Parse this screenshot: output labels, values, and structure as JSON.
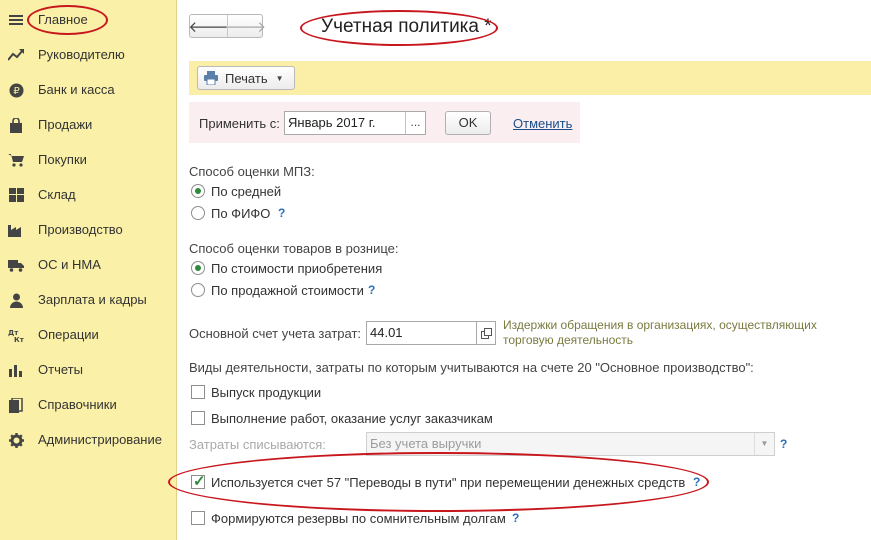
{
  "sidebar": {
    "items": [
      {
        "label": "Главное",
        "icon": "menu-icon"
      },
      {
        "label": "Руководителю",
        "icon": "trend-icon"
      },
      {
        "label": "Банк и касса",
        "icon": "ruble-icon"
      },
      {
        "label": "Продажи",
        "icon": "bag-icon"
      },
      {
        "label": "Покупки",
        "icon": "cart-icon"
      },
      {
        "label": "Склад",
        "icon": "warehouse-icon"
      },
      {
        "label": "Производство",
        "icon": "factory-icon"
      },
      {
        "label": "ОС и НМА",
        "icon": "truck-icon"
      },
      {
        "label": "Зарплата и кадры",
        "icon": "person-icon"
      },
      {
        "label": "Операции",
        "icon": "dt-kt-icon"
      },
      {
        "label": "Отчеты",
        "icon": "bar-chart-icon"
      },
      {
        "label": "Справочники",
        "icon": "books-icon"
      },
      {
        "label": "Администрирование",
        "icon": "gear-icon"
      }
    ]
  },
  "header": {
    "title": "Учетная политика *",
    "back_label": "🡐",
    "forward_label": "🡒"
  },
  "toolbar": {
    "print_label": "Печать"
  },
  "apply": {
    "label": "Применить с:",
    "date_value": "Январь 2017 г.",
    "dots_label": "...",
    "ok_label": "OK",
    "cancel_label": "Отменить"
  },
  "inventory": {
    "label": "Способ оценки МПЗ:",
    "options": [
      {
        "label": "По средней",
        "selected": true
      },
      {
        "label": "По ФИФО",
        "selected": false
      }
    ]
  },
  "retail": {
    "label": "Способ оценки товаров в рознице:",
    "options": [
      {
        "label": "По стоимости приобретения",
        "selected": true
      },
      {
        "label": "По продажной стоимости",
        "selected": false
      }
    ]
  },
  "cost_account": {
    "label": "Основной счет учета затрат:",
    "value": "44.01",
    "description": "Издержки обращения в организациях, осуществляющих торговую деятельность"
  },
  "activities": {
    "label": "Виды деятельности, затраты по которым учитываются на счете 20 \"Основное производство\":",
    "checkboxes": [
      {
        "label": "Выпуск продукции",
        "checked": false
      },
      {
        "label": "Выполнение работ, оказание услуг заказчикам",
        "checked": false
      }
    ]
  },
  "expenses": {
    "label": "Затраты списываются:",
    "value": "Без учета выручки"
  },
  "options": {
    "account57_label": "Используется счет 57 \"Переводы в пути\" при перемещении денежных средств",
    "account57_checked": true,
    "reserves_label": "Формируются резервы по сомнительным долгам",
    "reserves_checked": false
  },
  "help_mark": "?",
  "colors": {
    "sidebar_bg": "#fbf0a8",
    "accent_green": "#2d8a3c",
    "link_blue": "#1a4f8c",
    "annotation_red": "#c8161d"
  }
}
